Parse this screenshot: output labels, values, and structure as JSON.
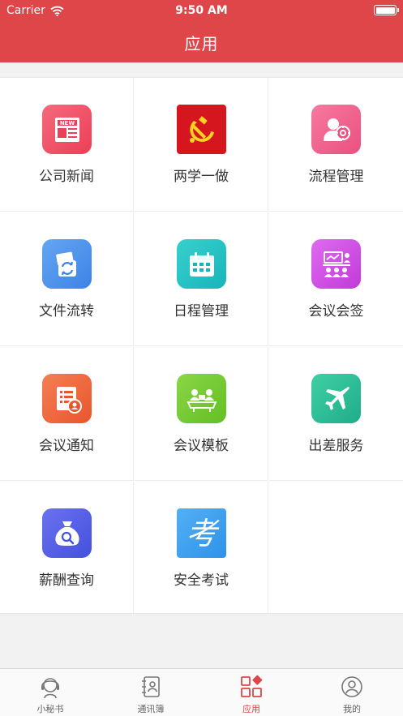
{
  "status_bar": {
    "carrier": "Carrier",
    "time": "9:50 AM"
  },
  "header": {
    "title": "应用"
  },
  "apps": [
    {
      "label": "公司新闻",
      "icon": "news-icon",
      "color": "#f2556a",
      "badge": "NEW"
    },
    {
      "label": "两学一做",
      "icon": "party-emblem-icon",
      "color": "#d6161e"
    },
    {
      "label": "流程管理",
      "icon": "workflow-icon",
      "color": "#f0648f"
    },
    {
      "label": "文件流转",
      "icon": "file-transfer-icon",
      "color": "#4f94ec"
    },
    {
      "label": "日程管理",
      "icon": "calendar-icon",
      "color": "#22c4c4"
    },
    {
      "label": "会议会签",
      "icon": "meeting-sign-icon",
      "color": "#cf4fe3"
    },
    {
      "label": "会议通知",
      "icon": "meeting-notice-icon",
      "color": "#f06a3e"
    },
    {
      "label": "会议模板",
      "icon": "meeting-template-icon",
      "color": "#79cc34"
    },
    {
      "label": "出差服务",
      "icon": "airplane-icon",
      "color": "#2fbe98"
    },
    {
      "label": "薪酬查询",
      "icon": "salary-query-icon",
      "color": "#5a63e6"
    },
    {
      "label": "安全考试",
      "icon": "exam-icon",
      "color": "#3fa3f0",
      "glyph": "考"
    }
  ],
  "tabbar": {
    "tabs": [
      {
        "label": "小秘书",
        "icon": "assistant-icon",
        "active": false
      },
      {
        "label": "通讯簿",
        "icon": "contacts-icon",
        "active": false
      },
      {
        "label": "应用",
        "icon": "apps-icon",
        "active": true
      },
      {
        "label": "我的",
        "icon": "profile-icon",
        "active": false
      }
    ],
    "active_color": "#de4649"
  }
}
